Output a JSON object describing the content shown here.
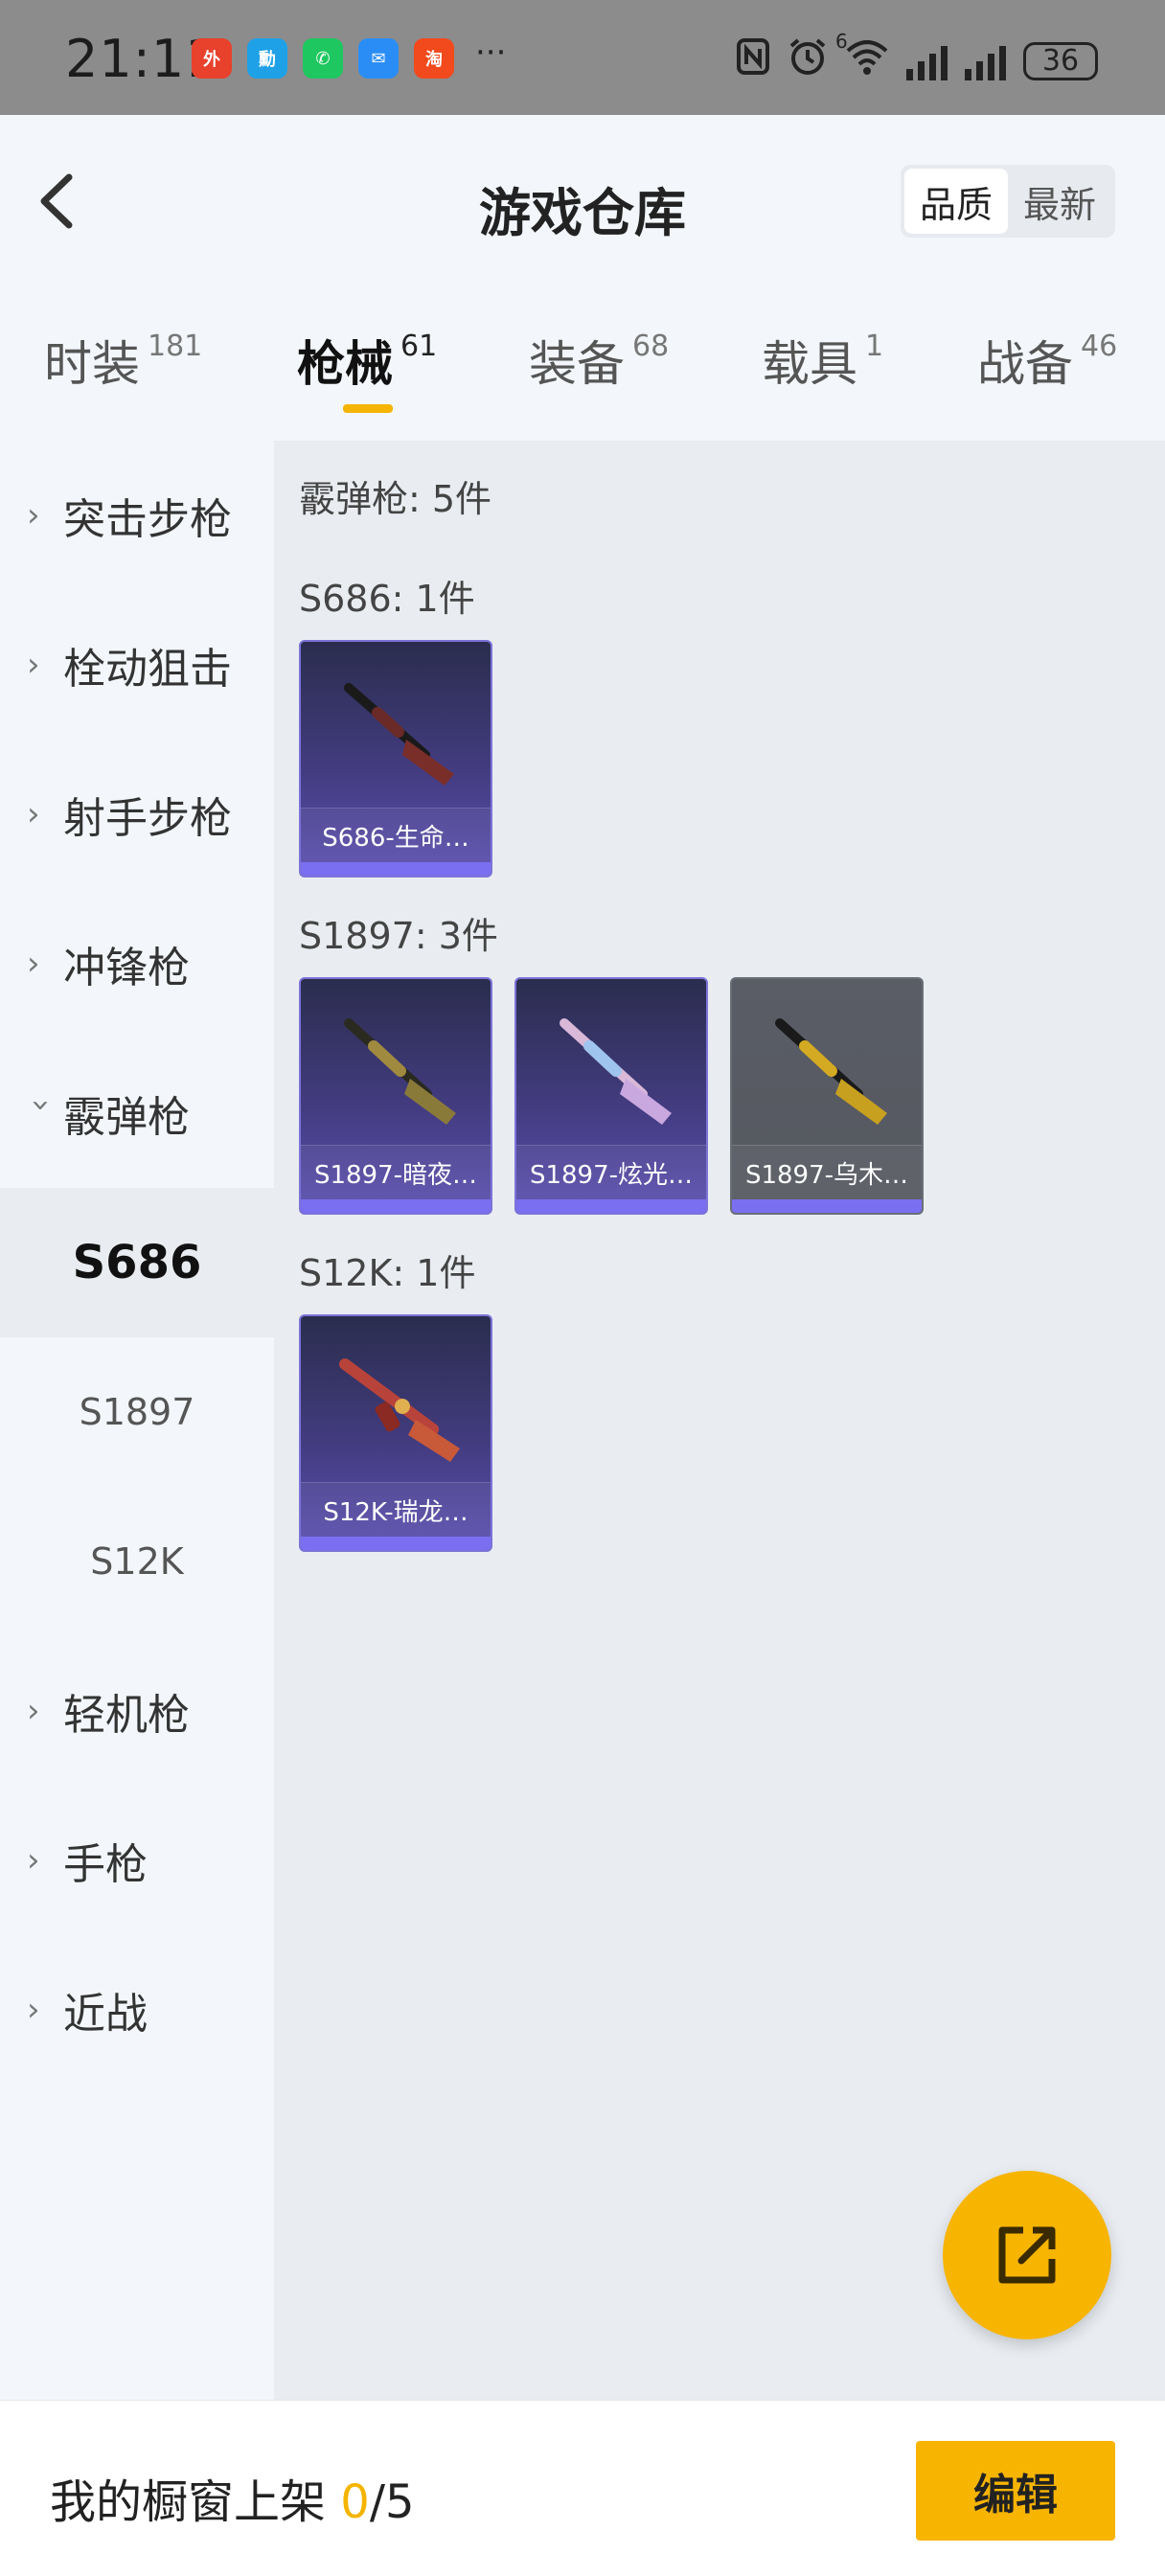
{
  "status_bar": {
    "time": "21:11",
    "apps": [
      {
        "icon": "takeaway-app-icon",
        "label": "外",
        "color": "#e8412c"
      },
      {
        "icon": "bike-app-icon",
        "label": "勳",
        "color": "#1fa1e8"
      },
      {
        "icon": "wechat-icon",
        "label": "✆",
        "color": "#1ec760"
      },
      {
        "icon": "message-app-icon",
        "label": "✉",
        "color": "#2a8df5"
      },
      {
        "icon": "taobao-icon",
        "label": "淘",
        "color": "#f24a1d"
      }
    ],
    "more": "···",
    "network_label": "6",
    "battery": "36"
  },
  "header": {
    "title": "游戏仓库",
    "sort_options": [
      "品质",
      "最新"
    ],
    "sort_active": 0
  },
  "tabs": [
    {
      "label": "时装",
      "count": "181"
    },
    {
      "label": "枪械",
      "count": "61"
    },
    {
      "label": "装备",
      "count": "68"
    },
    {
      "label": "载具",
      "count": "1"
    },
    {
      "label": "战备",
      "count": "46"
    }
  ],
  "active_tab": 1,
  "sidebar": {
    "categories": [
      "突击步枪",
      "栓动狙击",
      "射手步枪",
      "冲锋枪",
      "霰弹枪"
    ],
    "subcategories": [
      "S686",
      "S1897",
      "S12K"
    ],
    "categories_after": [
      "轻机枪",
      "手枪",
      "近战"
    ],
    "active_sub": "S686"
  },
  "content": {
    "summary": "霰弹枪: 5件",
    "groups": [
      {
        "title": "S686: 1件",
        "items": [
          "S686-生命…"
        ]
      },
      {
        "title": "S1897: 3件",
        "items": [
          "S1897-暗夜…",
          "S1897-炫光…",
          "S1897-乌木…"
        ]
      },
      {
        "title": "S12K: 1件",
        "items": [
          "S12K-瑞龙…"
        ]
      }
    ]
  },
  "bottom_bar": {
    "label": "我的橱窗上架 ",
    "current": "0",
    "total": "/5",
    "edit_label": "编辑"
  },
  "colors": {
    "accent": "#f7b400",
    "card_border": "#7c73d8",
    "content_bg": "#e9edf1"
  }
}
